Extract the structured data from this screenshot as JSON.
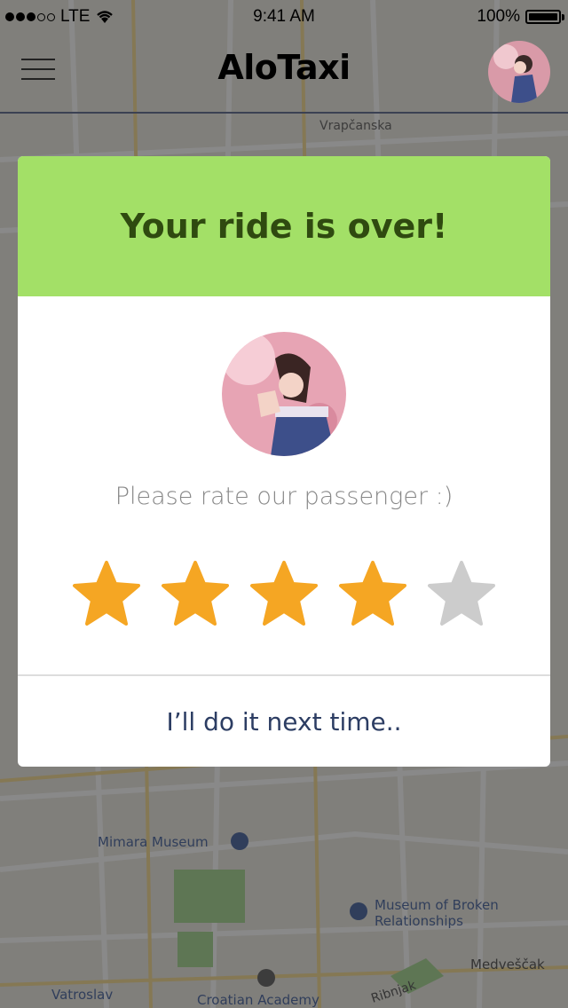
{
  "status_bar": {
    "carrier": "LTE",
    "time": "9:41 AM",
    "battery": "100%"
  },
  "nav": {
    "title": "AloTaxi",
    "menu_icon": "hamburger-icon",
    "avatar_icon": "user-avatar"
  },
  "map": {
    "labels": {
      "street1": "Vrapčanska",
      "poi1": "Mimara Museum",
      "poi2_line1": "Museum of Broken",
      "poi2_line2": "Relationships",
      "street2": "Medveščak",
      "street3": "Ribnjak",
      "poi3": "Croatian Academy",
      "street4": "Vatroslav"
    }
  },
  "modal": {
    "title": "Your ride is over!",
    "prompt": "Please rate our passenger :)",
    "rating": 4,
    "max_rating": 5,
    "later_label": "I’ll do it next time..",
    "colors": {
      "header_bg": "#a3e067",
      "title_text": "#2f4a10",
      "star_active": "#f5a623",
      "star_inactive": "#cccccc",
      "link_text": "#2c3d63"
    }
  }
}
